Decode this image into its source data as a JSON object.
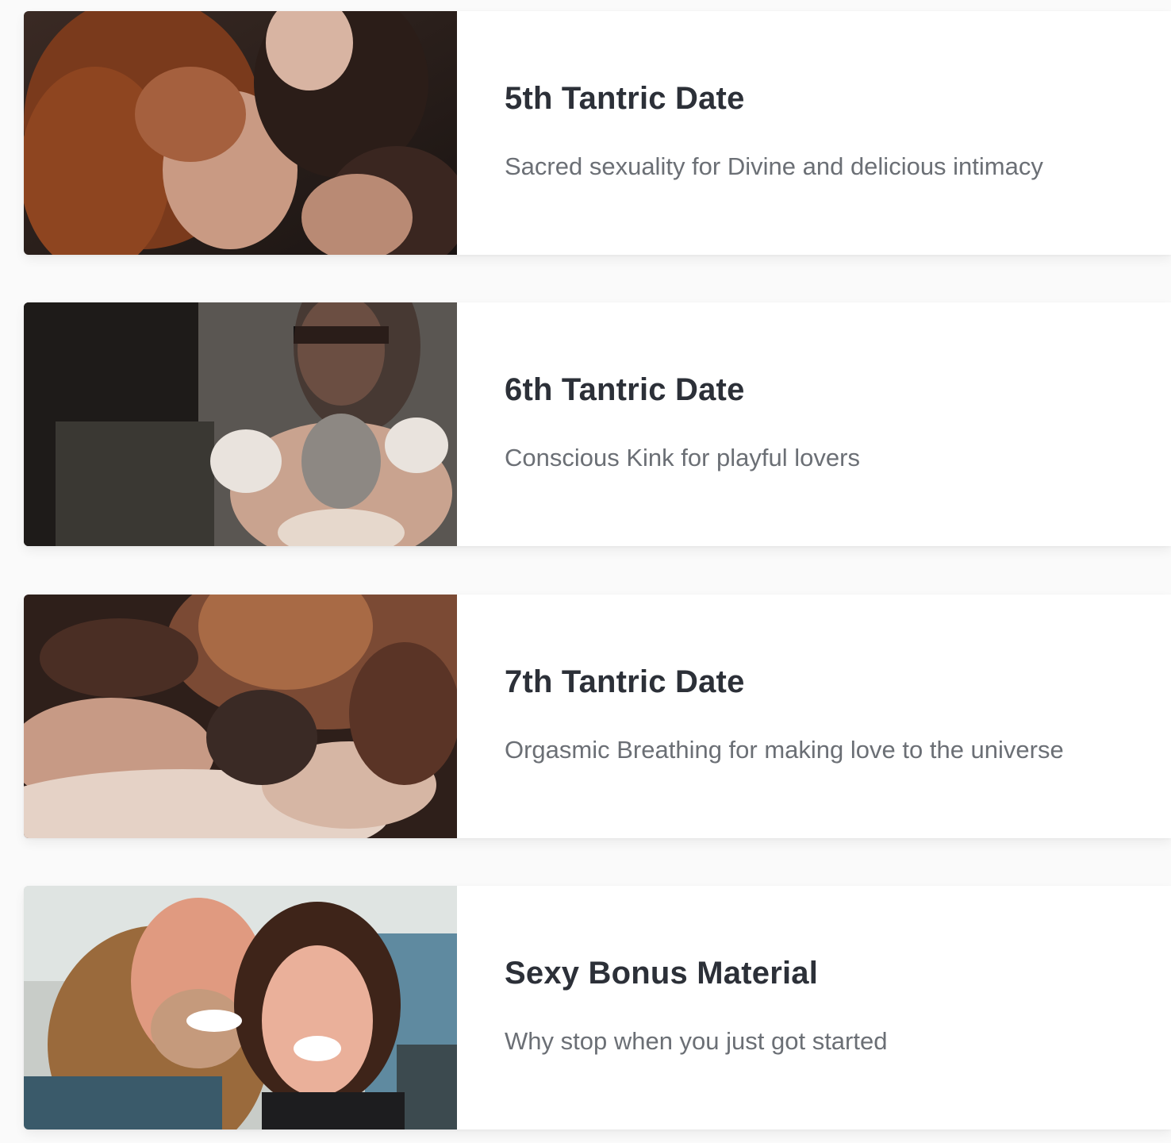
{
  "items": [
    {
      "title": "5th Tantric Date",
      "subtitle": "Sacred sexuality for Divine and delicious intimacy",
      "image": "couple-embrace-photo"
    },
    {
      "title": "6th Tantric Date",
      "subtitle": "Conscious Kink for playful lovers",
      "image": "blindfolded-woman-photo"
    },
    {
      "title": "7th Tantric Date",
      "subtitle": "Orgasmic Breathing for making love to the universe",
      "image": "holding-hands-photo"
    },
    {
      "title": "Sexy Bonus Material",
      "subtitle": "Why stop when you just got started",
      "image": "smiling-couple-selfie-photo"
    }
  ]
}
